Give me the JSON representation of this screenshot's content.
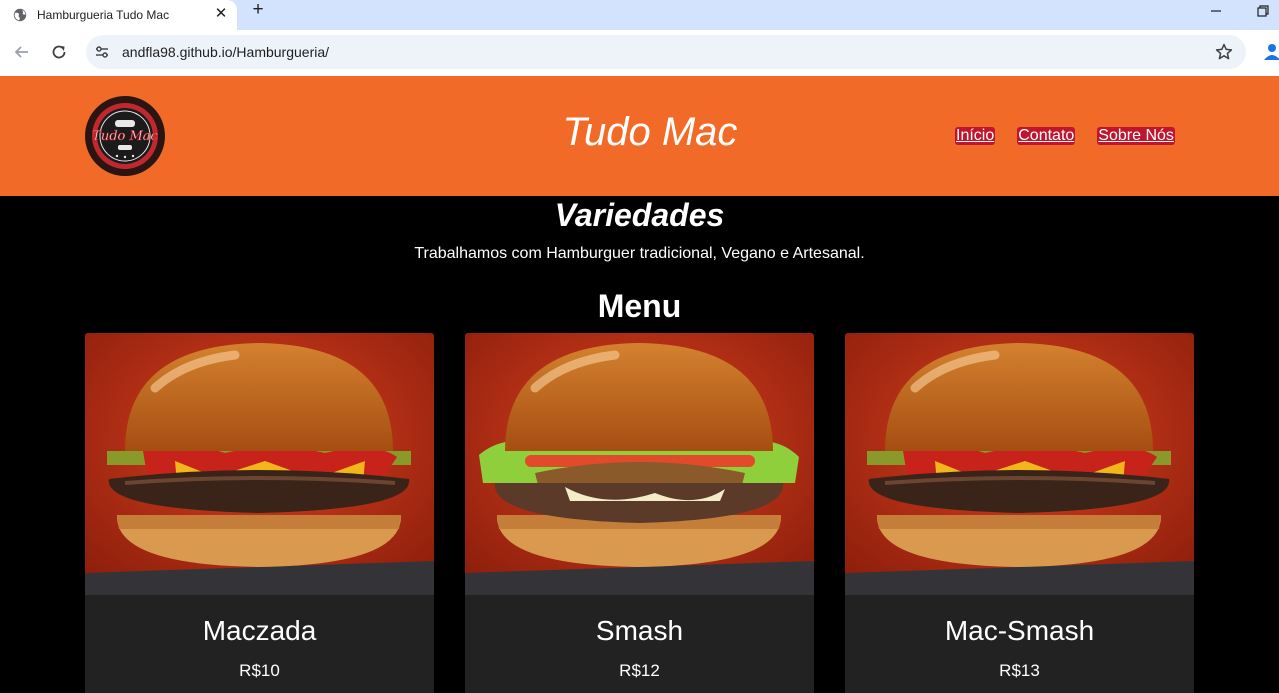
{
  "browser": {
    "tab_title": "Hamburgueria Tudo Mac",
    "tab_close": "✕",
    "new_tab": "+",
    "url": "andfla98.github.io/Hamburgueria/"
  },
  "header": {
    "logo_text": "Tudo Mac",
    "title": "Tudo Mac",
    "nav": [
      "Início",
      "Contato",
      "Sobre Nós"
    ]
  },
  "main": {
    "heading": "Variedades",
    "subtitle": "Trabalhamos com Hamburguer tradicional, Vegano e Artesanal.",
    "menu_heading": "Menu"
  },
  "menu": [
    {
      "name": "Maczada",
      "price": "R$10",
      "style": "classic"
    },
    {
      "name": "Smash",
      "price": "R$12",
      "style": "lettuce"
    },
    {
      "name": "Mac-Smash",
      "price": "R$13",
      "style": "classic"
    }
  ],
  "colors": {
    "header_bg": "#f26a27",
    "nav_link_bg": "#c0152e",
    "page_bg": "#000000",
    "card_bg": "#222222"
  }
}
